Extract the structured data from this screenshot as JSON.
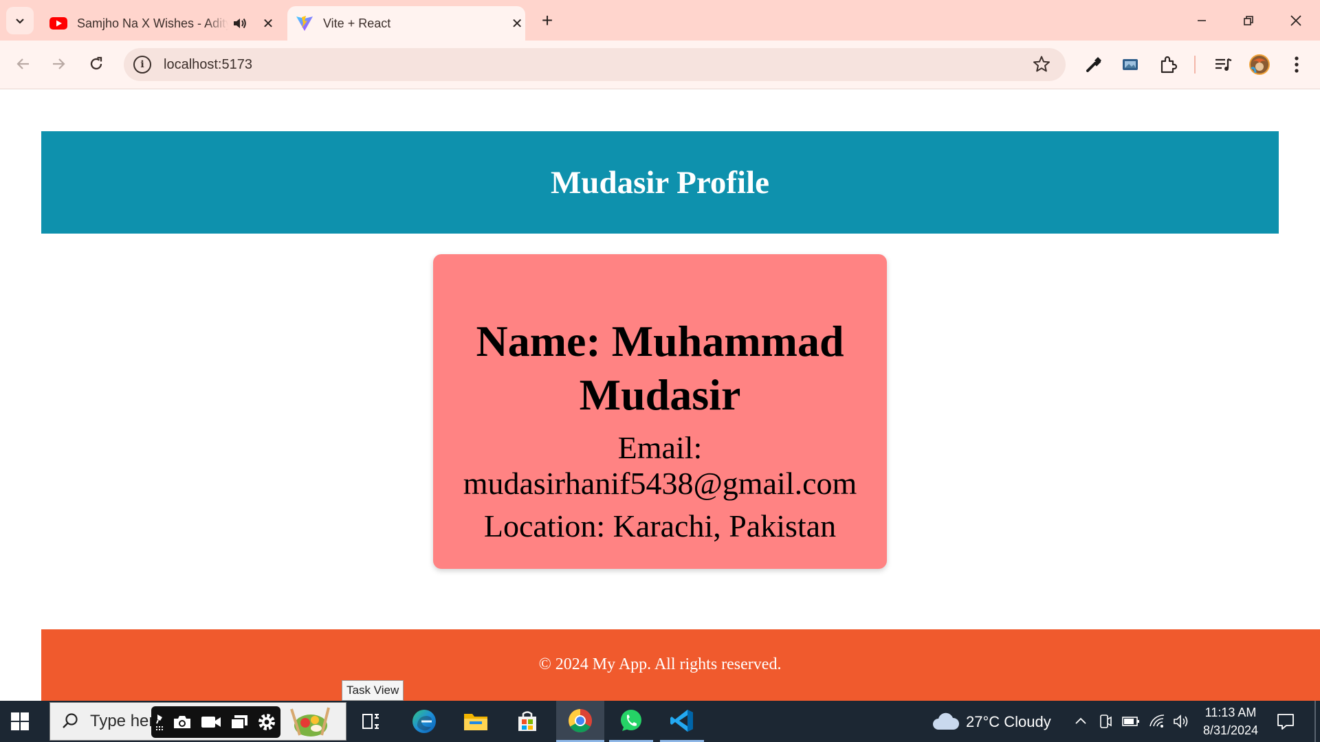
{
  "browser": {
    "tabs": [
      {
        "title": "Samjho Na X Wishes - Aditya",
        "favicon": "youtube-icon",
        "audio": true
      },
      {
        "title": "Vite + React",
        "favicon": "vite-icon",
        "active": true
      }
    ],
    "address": "localhost:5173"
  },
  "page": {
    "header_title": "Mudasir Profile",
    "card": {
      "name": "Name: Muhammad Mudasir",
      "email_label": "Email:",
      "email": "mudasirhanif5438@gmail.com",
      "location": "Location: Karachi, Pakistan"
    },
    "footer": "© 2024 My App. All rights reserved."
  },
  "tooltip": "Task View",
  "taskbar": {
    "search_placeholder": "Type her",
    "weather": "27°C  Cloudy",
    "time": "11:13 AM",
    "date": "8/31/2024"
  },
  "colors": {
    "header_bg": "#0e91ad",
    "card_bg": "#ff8383",
    "footer_bg": "#f05a2d",
    "tabstrip_bg": "#ffd5cd"
  }
}
